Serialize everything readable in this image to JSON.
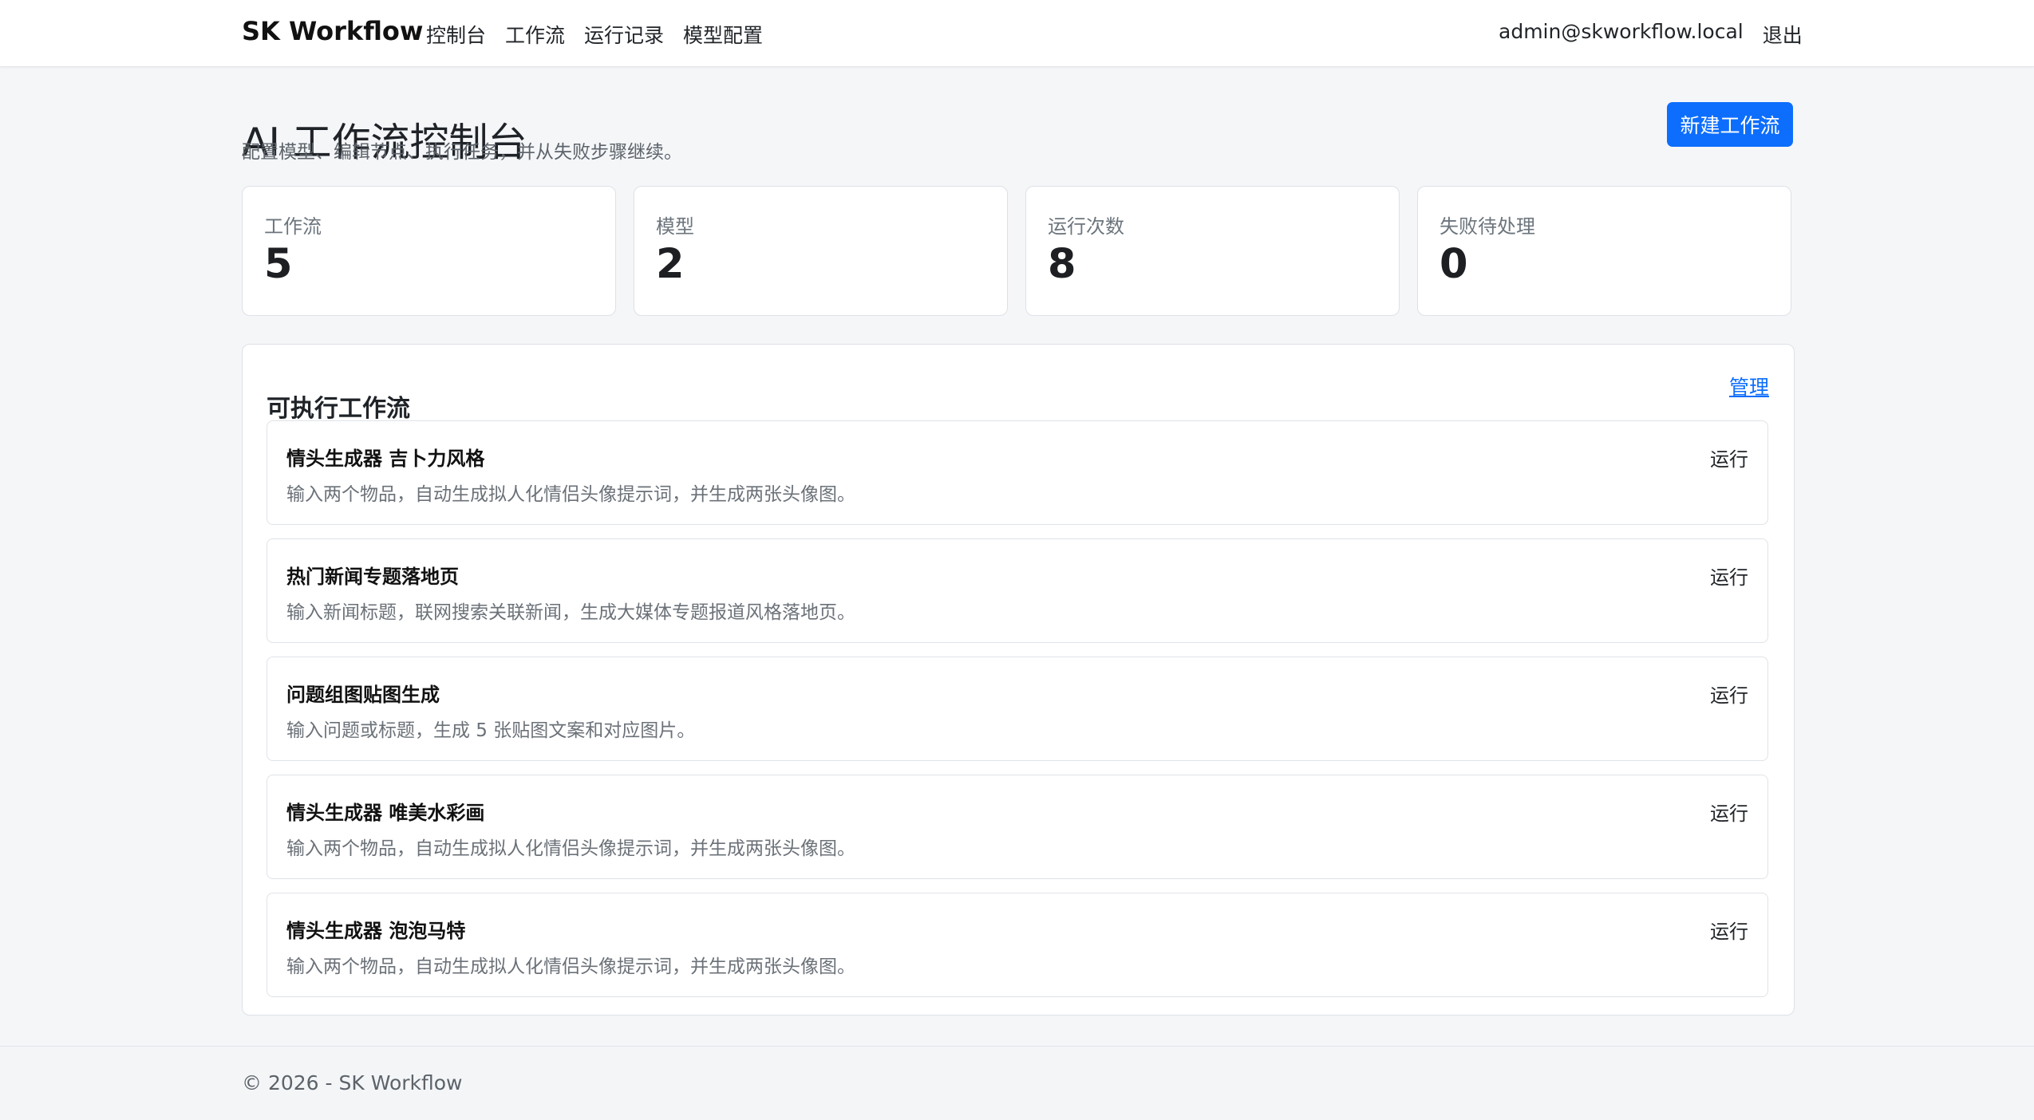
{
  "header": {
    "brand": "SK Workflow",
    "nav": {
      "dashboard": "控制台",
      "workflows": "工作流",
      "runs": "运行记录",
      "models": "模型配置"
    },
    "user_email": "admin@skworkflow.local",
    "logout": "退出"
  },
  "page": {
    "title": "AI 工作流控制台",
    "subtitle": "配置模型、编辑节点、执行任务，并从失败步骤继续。",
    "new_workflow_button": "新建工作流"
  },
  "stats": [
    {
      "label": "工作流",
      "value": "5"
    },
    {
      "label": "模型",
      "value": "2"
    },
    {
      "label": "运行次数",
      "value": "8"
    },
    {
      "label": "失败待处理",
      "value": "0"
    }
  ],
  "executable_workflows": {
    "title": "可执行工作流",
    "manage_label": "管理",
    "items": [
      {
        "name": "情头生成器 吉卜力风格",
        "description": "输入两个物品，自动生成拟人化情侣头像提示词，并生成两张头像图。",
        "action": "运行"
      },
      {
        "name": "热门新闻专题落地页",
        "description": "输入新闻标题，联网搜索关联新闻，生成大媒体专题报道风格落地页。",
        "action": "运行"
      },
      {
        "name": "问题组图贴图生成",
        "description": "输入问题或标题，生成 5 张贴图文案和对应图片。",
        "action": "运行"
      },
      {
        "name": "情头生成器 唯美水彩画",
        "description": "输入两个物品，自动生成拟人化情侣头像提示词，并生成两张头像图。",
        "action": "运行"
      },
      {
        "name": "情头生成器 泡泡马特",
        "description": "输入两个物品，自动生成拟人化情侣头像提示词，并生成两张头像图。",
        "action": "运行"
      }
    ]
  },
  "footer": {
    "copyright": "© 2026 - SK Workflow"
  },
  "colors": {
    "primary": "#0d6efd",
    "background": "#f5f6f8",
    "card": "#ffffff",
    "border": "#dde1e6",
    "muted_text": "#6c757d"
  }
}
